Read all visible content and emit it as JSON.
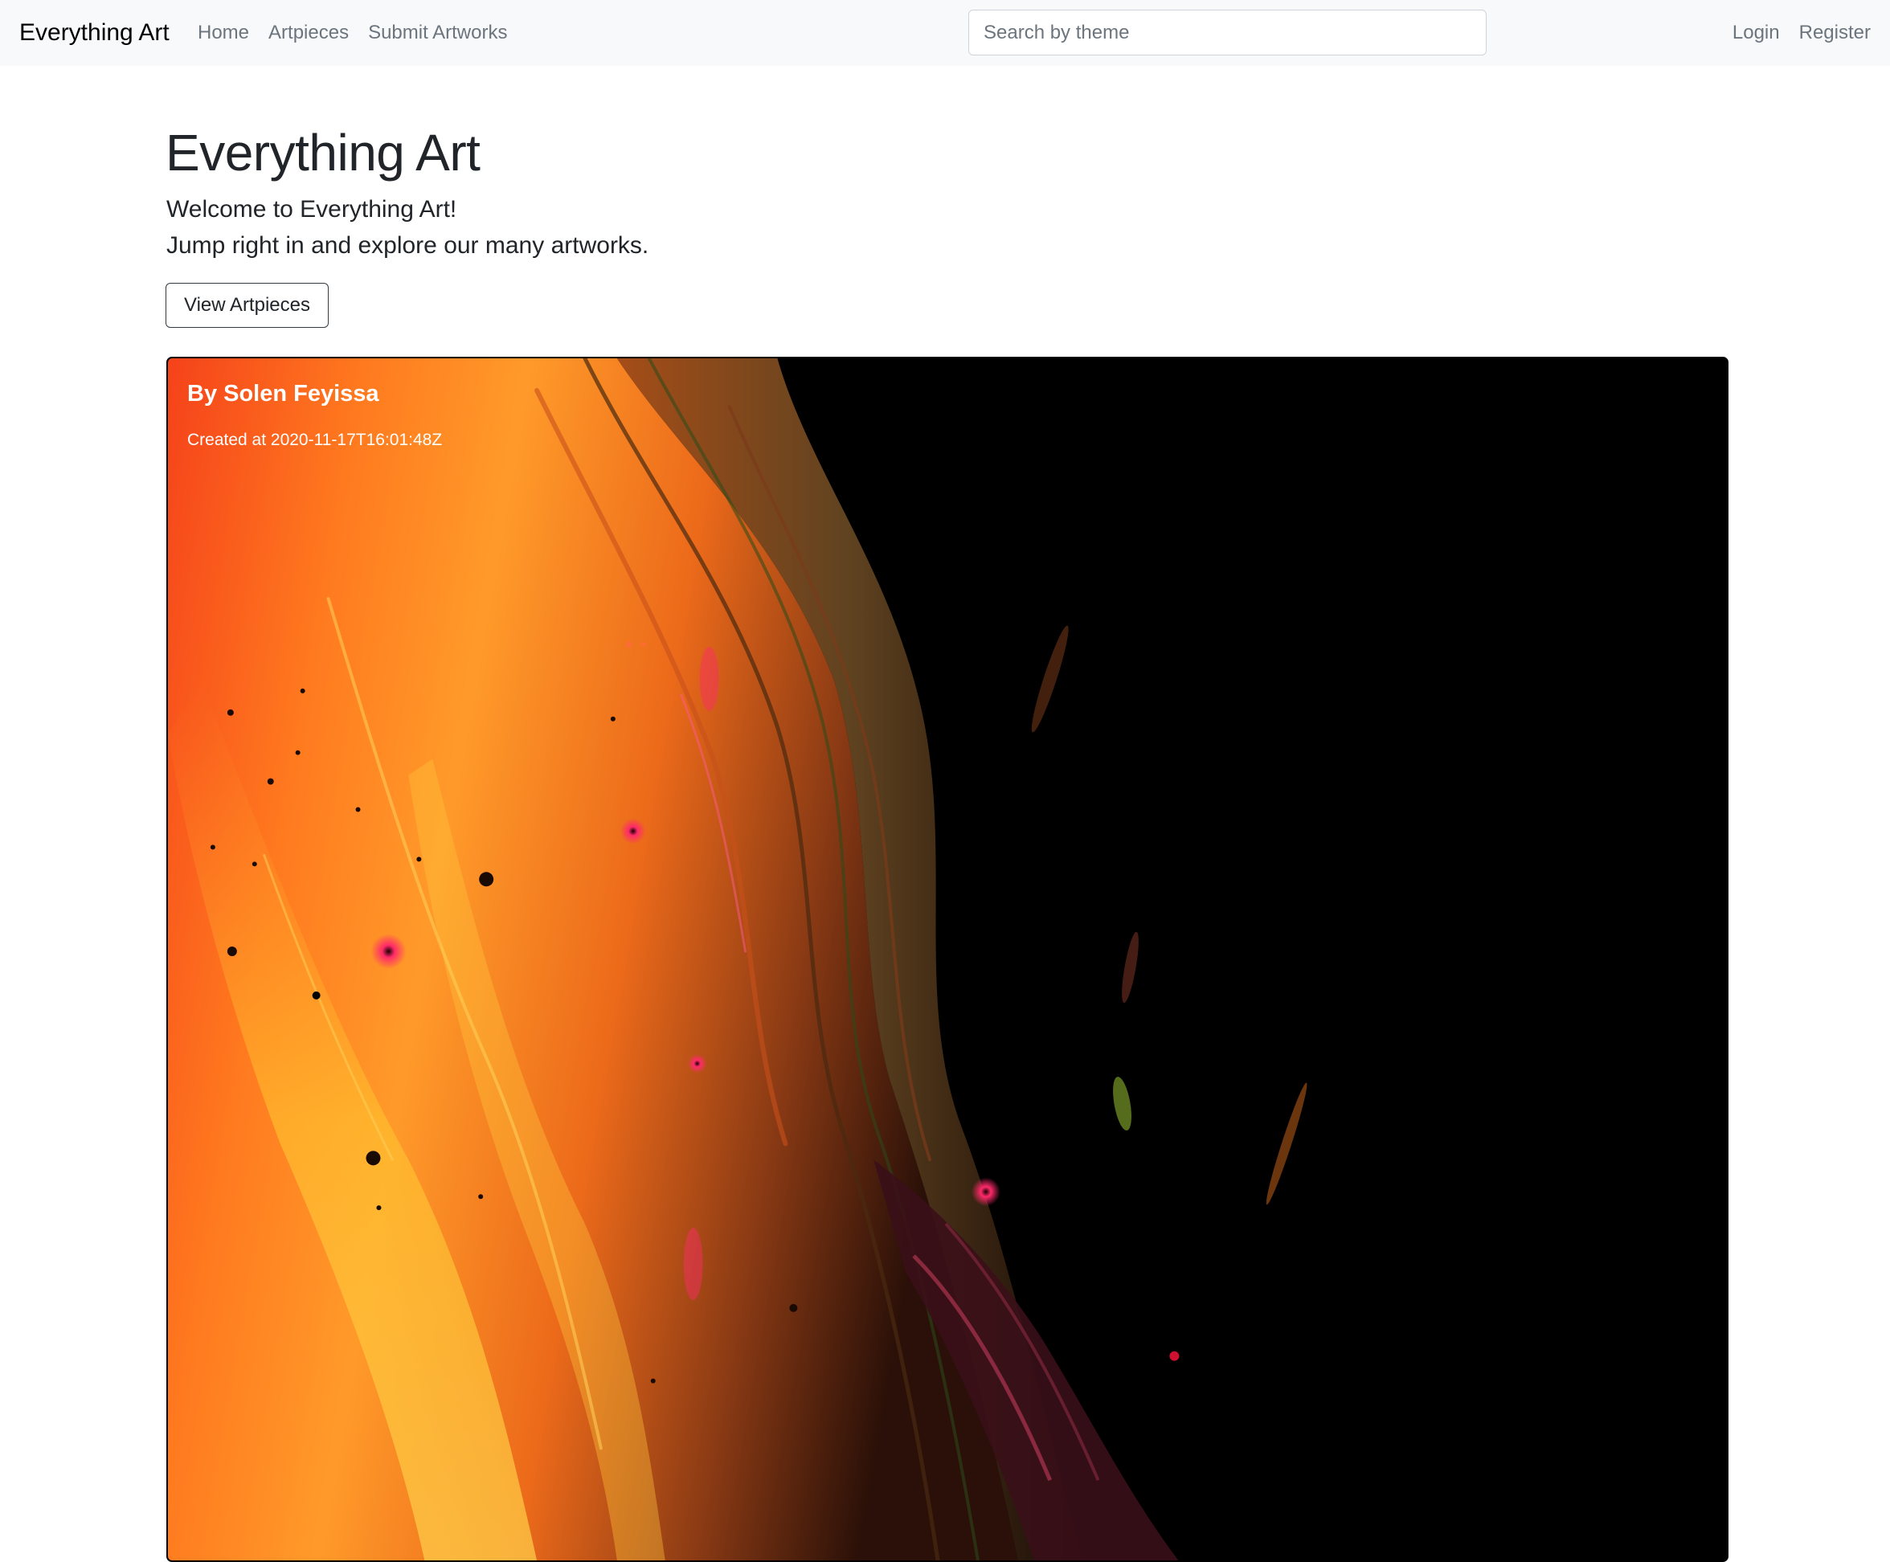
{
  "navbar": {
    "brand": "Everything Art",
    "links": [
      {
        "label": "Home"
      },
      {
        "label": "Artpieces"
      },
      {
        "label": "Submit Artworks"
      }
    ],
    "search": {
      "placeholder": "Search by theme",
      "value": ""
    },
    "auth": {
      "login": "Login",
      "register": "Register"
    }
  },
  "hero": {
    "title": "Everything Art",
    "lead_line1": "Welcome to Everything Art!",
    "lead_line2": "Jump right in and explore our many artworks.",
    "button_label": "View Artpieces"
  },
  "artwork_card": {
    "author": "By Solen Feyissa",
    "created": "Created at 2020-11-17T16:01:48Z",
    "image_subject": "abstract orange and black fluid paint",
    "colors": {
      "orange": "#ff7a1f",
      "yellow": "#ffc12e",
      "red": "#f23a10",
      "pink": "#ff2a6a",
      "background": "#000000"
    }
  }
}
